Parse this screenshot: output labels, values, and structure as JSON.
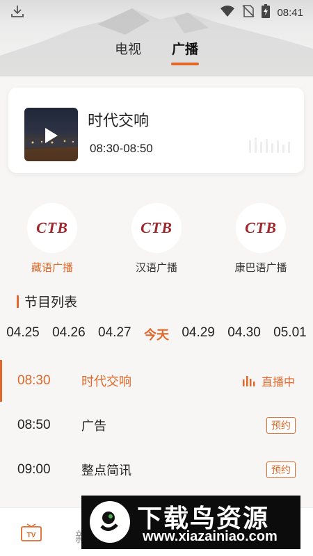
{
  "status_bar": {
    "time": "08:41"
  },
  "top_tabs": [
    {
      "label": "电视",
      "active": false
    },
    {
      "label": "广播",
      "active": true
    }
  ],
  "now_playing": {
    "title": "时代交响",
    "time_range": "08:30-08:50"
  },
  "stations": [
    {
      "logo_text": "CTB",
      "label": "藏语广播",
      "active": true
    },
    {
      "logo_text": "CTB",
      "label": "汉语广播",
      "active": false
    },
    {
      "logo_text": "CTB",
      "label": "康巴语广播",
      "active": false
    }
  ],
  "program_list": {
    "header": "节目列表",
    "dates": [
      "04.25",
      "04.26",
      "04.27",
      "今天",
      "04.29",
      "04.30",
      "05.01"
    ],
    "active_date_index": 3,
    "programs": [
      {
        "time": "08:30",
        "name": "时代交响",
        "status": "直播中",
        "live": true
      },
      {
        "time": "08:50",
        "name": "广告",
        "status": "预约",
        "live": false
      },
      {
        "time": "09:00",
        "name": "整点简讯",
        "status": "预约",
        "live": false
      }
    ]
  },
  "bottom_nav": {
    "tv_icon_label": "TV",
    "partial_label": "新"
  },
  "watermark": {
    "title": "下载鸟资源",
    "url": "www.xiazainiao.com"
  },
  "colors": {
    "accent": "#e0682a",
    "logo_red": "#a0272c"
  }
}
